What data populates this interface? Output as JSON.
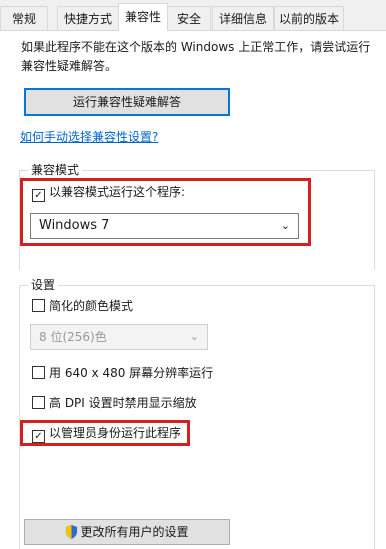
{
  "tabs": [
    {
      "label": "常规"
    },
    {
      "label": "快捷方式"
    },
    {
      "label": "兼容性"
    },
    {
      "label": "安全"
    },
    {
      "label": "详细信息"
    },
    {
      "label": "以前的版本"
    }
  ],
  "intro_text": "如果此程序不能在这个版本的 Windows 上正常工作，请尝试运行兼容性疑难解答。",
  "troubleshoot_button": "运行兼容性疑难解答",
  "manual_link": "如何手动选择兼容性设置?",
  "compat_mode": {
    "title": "兼容模式",
    "checkbox_label": "以兼容模式运行这个程序:",
    "checked": true,
    "selected_os": "Windows 7"
  },
  "settings": {
    "title": "设置",
    "reduced_color": {
      "label": "简化的颜色模式",
      "checked": false
    },
    "color_depth": {
      "selected": "8 位(256)色",
      "disabled": true
    },
    "res_640": {
      "label": "用 640 x 480 屏幕分辨率运行",
      "checked": false
    },
    "high_dpi": {
      "label": "高 DPI 设置时禁用显示缩放",
      "checked": false
    },
    "run_as_admin": {
      "label": "以管理员身份运行此程序",
      "checked": true
    }
  },
  "all_users_button": "更改所有用户的设置",
  "icons": {
    "dropdown": "chevron-down-icon",
    "shield": "shield-icon",
    "check": "checkmark-icon"
  },
  "colors": {
    "highlight_box": "#d42020",
    "link": "#0066cc",
    "focus": "#0078d7"
  }
}
